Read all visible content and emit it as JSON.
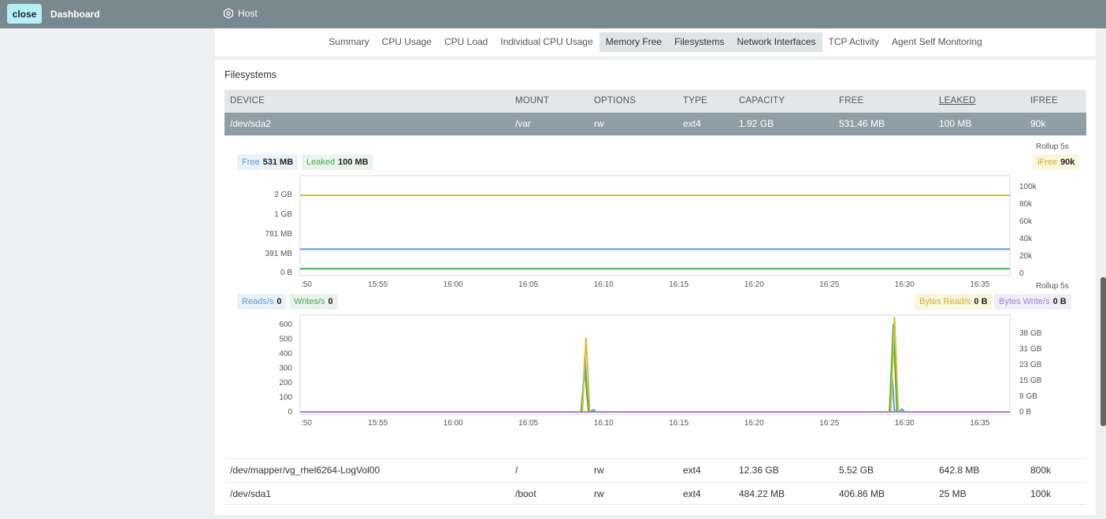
{
  "topbar": {
    "close_label": "close",
    "dashboard_label": "Dashboard",
    "host_label": "Host"
  },
  "tabs": [
    {
      "label": "Summary",
      "highlighted": false
    },
    {
      "label": "CPU Usage",
      "highlighted": false
    },
    {
      "label": "CPU Load",
      "highlighted": false
    },
    {
      "label": "Individual CPU Usage",
      "highlighted": false
    },
    {
      "label": "Memory Free",
      "highlighted": true
    },
    {
      "label": "Filesystems",
      "highlighted": true
    },
    {
      "label": "Network Interfaces",
      "highlighted": true
    },
    {
      "label": "TCP Activity",
      "highlighted": false
    },
    {
      "label": "Agent Self Monitoring",
      "highlighted": false
    }
  ],
  "section_title": "Filesystems",
  "table": {
    "headers": [
      "DEVICE",
      "MOUNT",
      "OPTIONS",
      "TYPE",
      "CAPACITY",
      "FREE",
      "LEAKED",
      "IFREE"
    ],
    "selected_row": [
      "/dev/sda2",
      "/var",
      "rw",
      "ext4",
      "1.92 GB",
      "531.46 MB",
      "100 MB",
      "90k"
    ],
    "rows": [
      [
        "/dev/mapper/vg_rhel6264-LogVol00",
        "/",
        "rw",
        "ext4",
        "12.36 GB",
        "5.52 GB",
        "642.8 MB",
        "800k"
      ],
      [
        "/dev/sda1",
        "/boot",
        "rw",
        "ext4",
        "484.22 MB",
        "406.86 MB",
        "25 MB",
        "100k"
      ]
    ]
  },
  "chart1": {
    "rollup": "Rollup 5s",
    "legend": [
      {
        "name": "Free",
        "value": "531 MB"
      },
      {
        "name": "Leaked",
        "value": "100 MB"
      },
      {
        "name": "iFree",
        "value": "90k"
      }
    ]
  },
  "chart2": {
    "rollup": "Rollup 5s",
    "legend": [
      {
        "name": "Reads/s",
        "value": "0"
      },
      {
        "name": "Writes/s",
        "value": "0"
      },
      {
        "name": "Bytes Read/s",
        "value": "0 B"
      },
      {
        "name": "Bytes Write/s",
        "value": "0 B"
      }
    ]
  },
  "chart_data": [
    {
      "type": "line",
      "x_ticks": [
        ":50",
        "15:55",
        "16:00",
        "16:05",
        "16:10",
        "16:15",
        "16:20",
        "16:25",
        "16:30",
        "16:35"
      ],
      "x_range": [
        "15:49:50",
        "16:37:00"
      ],
      "y_left_ticks": [
        "0 B",
        "391 MB",
        "781 MB",
        "1 GB",
        "2 GB"
      ],
      "y_left_range_mb": [
        0,
        2100
      ],
      "y_right_ticks": [
        "0",
        "20k",
        "40k",
        "60k",
        "80k",
        "100k"
      ],
      "y_right_range": [
        0,
        110000
      ],
      "series": [
        {
          "name": "Free",
          "axis": "left",
          "color": "#5b9bd5",
          "x": [
            "15:49:50",
            "16:37:00"
          ],
          "y": [
            531,
            531
          ]
        },
        {
          "name": "Leaked",
          "axis": "left",
          "color": "#4aa856",
          "x": [
            "15:49:50",
            "16:37:00"
          ],
          "y": [
            100,
            100
          ]
        },
        {
          "name": "iFree",
          "axis": "right",
          "color": "#d4c030",
          "x": [
            "15:49:50",
            "16:37:00"
          ],
          "y": [
            90000,
            90000
          ]
        }
      ]
    },
    {
      "type": "line",
      "x_ticks": [
        ":50",
        "15:55",
        "16:00",
        "16:05",
        "16:10",
        "16:15",
        "16:20",
        "16:25",
        "16:30",
        "16:35"
      ],
      "x_range": [
        "15:49:50",
        "16:37:00"
      ],
      "y_left_ticks": [
        "0",
        "100",
        "200",
        "300",
        "400",
        "500",
        "600"
      ],
      "y_left_range": [
        0,
        650
      ],
      "y_right_ticks": [
        "0 B",
        "8 GB",
        "15 GB",
        "23 GB",
        "31 GB",
        "38 GB"
      ],
      "y_right_range_gb": [
        0,
        46
      ],
      "series": [
        {
          "name": "Reads/s",
          "axis": "left",
          "color": "#5b9bd5",
          "x": [
            "15:49:50",
            "16:08:35",
            "16:08:45",
            "16:08:55",
            "16:09:05",
            "16:09:20",
            "16:09:30",
            "16:29:00",
            "16:29:10",
            "16:29:20",
            "16:29:30",
            "16:29:40",
            "16:29:50",
            "16:30:00",
            "16:37:00"
          ],
          "y": [
            0,
            0,
            380,
            100,
            0,
            15,
            0,
            0,
            250,
            0,
            10,
            0,
            20,
            0,
            0
          ]
        },
        {
          "name": "Writes/s",
          "axis": "left",
          "color": "#4aa856",
          "x": [
            "15:49:50",
            "16:08:30",
            "16:08:45",
            "16:09:00",
            "16:09:10",
            "16:29:00",
            "16:29:15",
            "16:29:30",
            "16:37:00"
          ],
          "y": [
            0,
            0,
            300,
            0,
            0,
            0,
            600,
            0,
            0
          ]
        },
        {
          "name": "Bytes Read/s",
          "axis": "right",
          "color": "#d4c030",
          "x": [
            "15:49:50",
            "16:08:35",
            "16:08:50",
            "16:09:05",
            "16:29:05",
            "16:29:20",
            "16:29:35",
            "16:37:00"
          ],
          "y": [
            0,
            0,
            36,
            0,
            0,
            46,
            0,
            0
          ]
        },
        {
          "name": "Bytes Write/s",
          "axis": "right",
          "color": "#a47fcf",
          "x": [
            "15:49:50",
            "16:37:00"
          ],
          "y": [
            0,
            0
          ]
        }
      ]
    }
  ]
}
